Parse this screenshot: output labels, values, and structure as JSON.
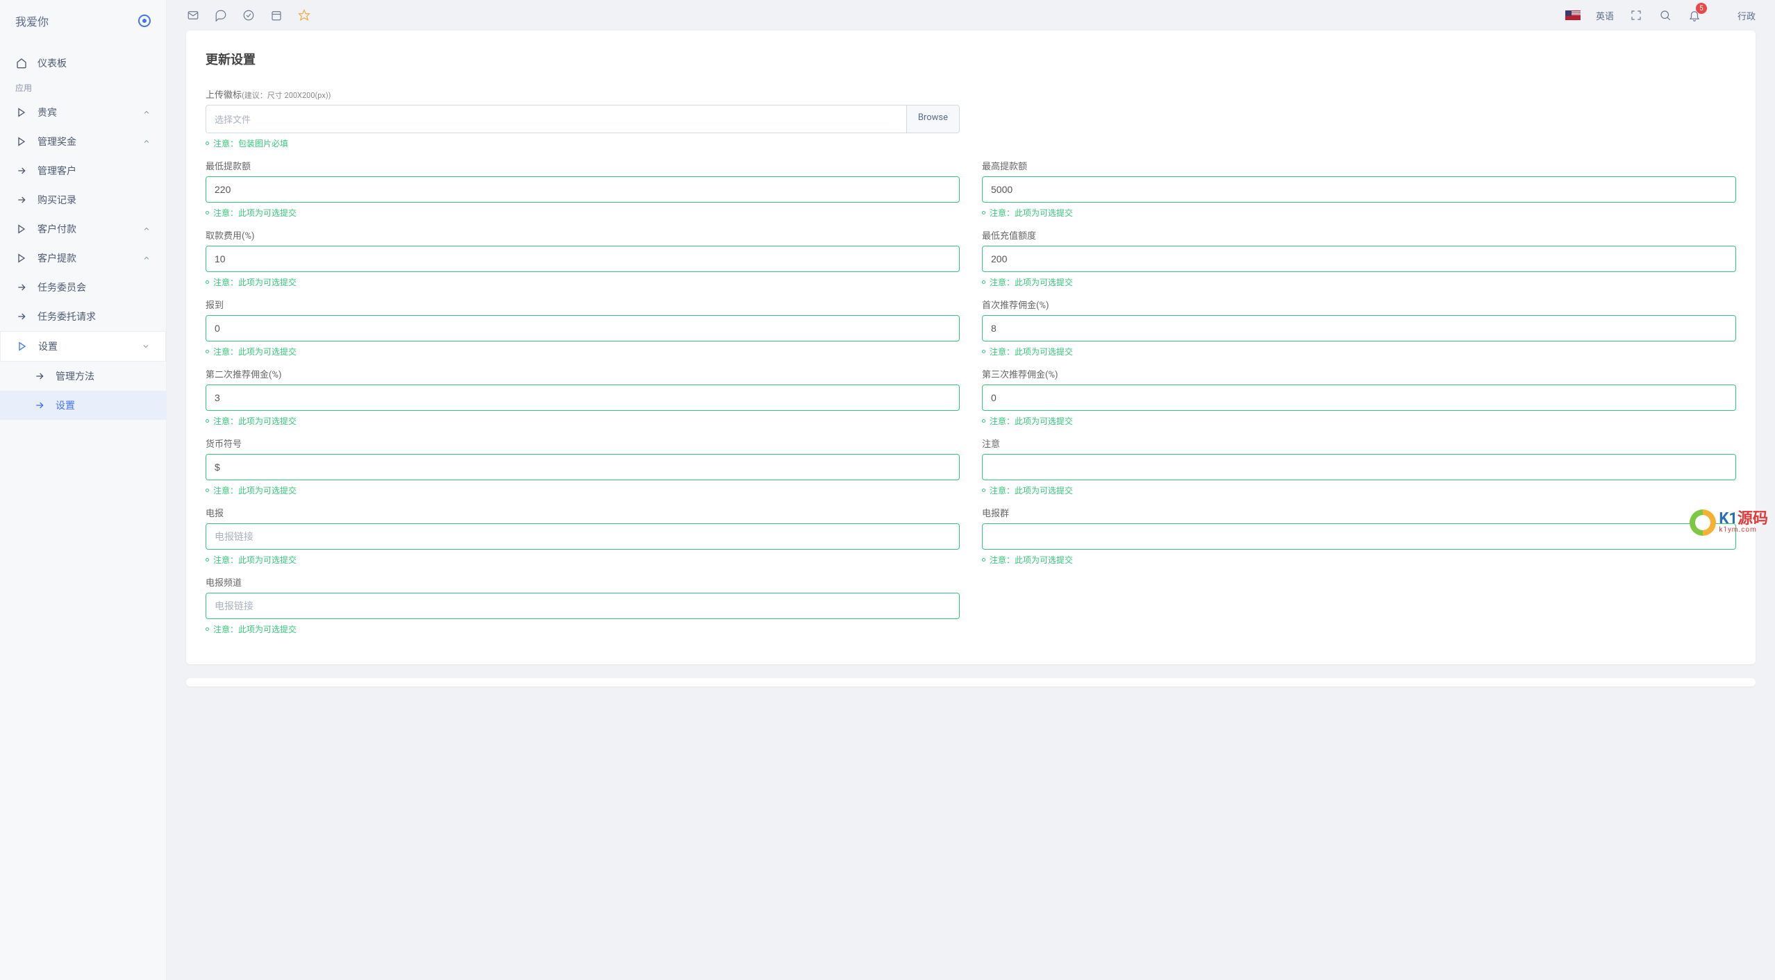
{
  "sidebar": {
    "logo": "我爱你",
    "section_label": "应用",
    "items": [
      {
        "icon": "home",
        "label": "仪表板",
        "expandable": false
      },
      {
        "icon": "play",
        "label": "贵宾",
        "expandable": true
      },
      {
        "icon": "play",
        "label": "管理奖金",
        "expandable": true
      },
      {
        "icon": "arrow",
        "label": "管理客户",
        "expandable": false
      },
      {
        "icon": "arrow",
        "label": "购买记录",
        "expandable": false
      },
      {
        "icon": "play",
        "label": "客户付款",
        "expandable": true
      },
      {
        "icon": "play",
        "label": "客户提款",
        "expandable": true
      },
      {
        "icon": "arrow",
        "label": "任务委员会",
        "expandable": false
      },
      {
        "icon": "arrow",
        "label": "任务委托请求",
        "expandable": false
      },
      {
        "icon": "play",
        "label": "设置",
        "expandable": true,
        "expanded": true,
        "highlight": true
      },
      {
        "icon": "arrow",
        "label": "管理方法",
        "expandable": false,
        "sub": true
      },
      {
        "icon": "arrow",
        "label": "设置",
        "expandable": false,
        "sub": true,
        "active": true
      }
    ]
  },
  "topbar": {
    "language": "英语",
    "admin": "行政",
    "notifications": "5"
  },
  "page": {
    "title": "更新设置",
    "upload_label": "上传徽标",
    "upload_hint": "(建议：尺寸 200X200(px))",
    "file_placeholder": "选择文件",
    "browse": "Browse",
    "note_required": "注意：包装图片必填",
    "note_optional": "注意：此项为可选提交",
    "fields": {
      "min_withdraw": {
        "label": "最低提款额",
        "value": "220"
      },
      "max_withdraw": {
        "label": "最高提款额",
        "value": "5000"
      },
      "withdraw_fee": {
        "label": "取款费用(%)",
        "value": "10"
      },
      "min_recharge": {
        "label": "最低充值额度",
        "value": "200"
      },
      "checkin": {
        "label": "报到",
        "value": "0"
      },
      "first_ref": {
        "label": "首次推荐佣金(%)",
        "value": "8"
      },
      "second_ref": {
        "label": "第二次推荐佣金(%)",
        "value": "3"
      },
      "third_ref": {
        "label": "第三次推荐佣金(%)",
        "value": "0"
      },
      "currency": {
        "label": "货币符号",
        "value": "$"
      },
      "notice": {
        "label": "注意",
        "value": ""
      },
      "telegram": {
        "label": "电报",
        "placeholder": "电报链接",
        "value": ""
      },
      "telegram_group": {
        "label": "电报群",
        "value": ""
      },
      "telegram_channel": {
        "label": "电报频道",
        "placeholder": "电报链接",
        "value": ""
      }
    }
  },
  "watermark": {
    "main1": "K1",
    "main2": "源码",
    "sub": "k1ym.com"
  }
}
